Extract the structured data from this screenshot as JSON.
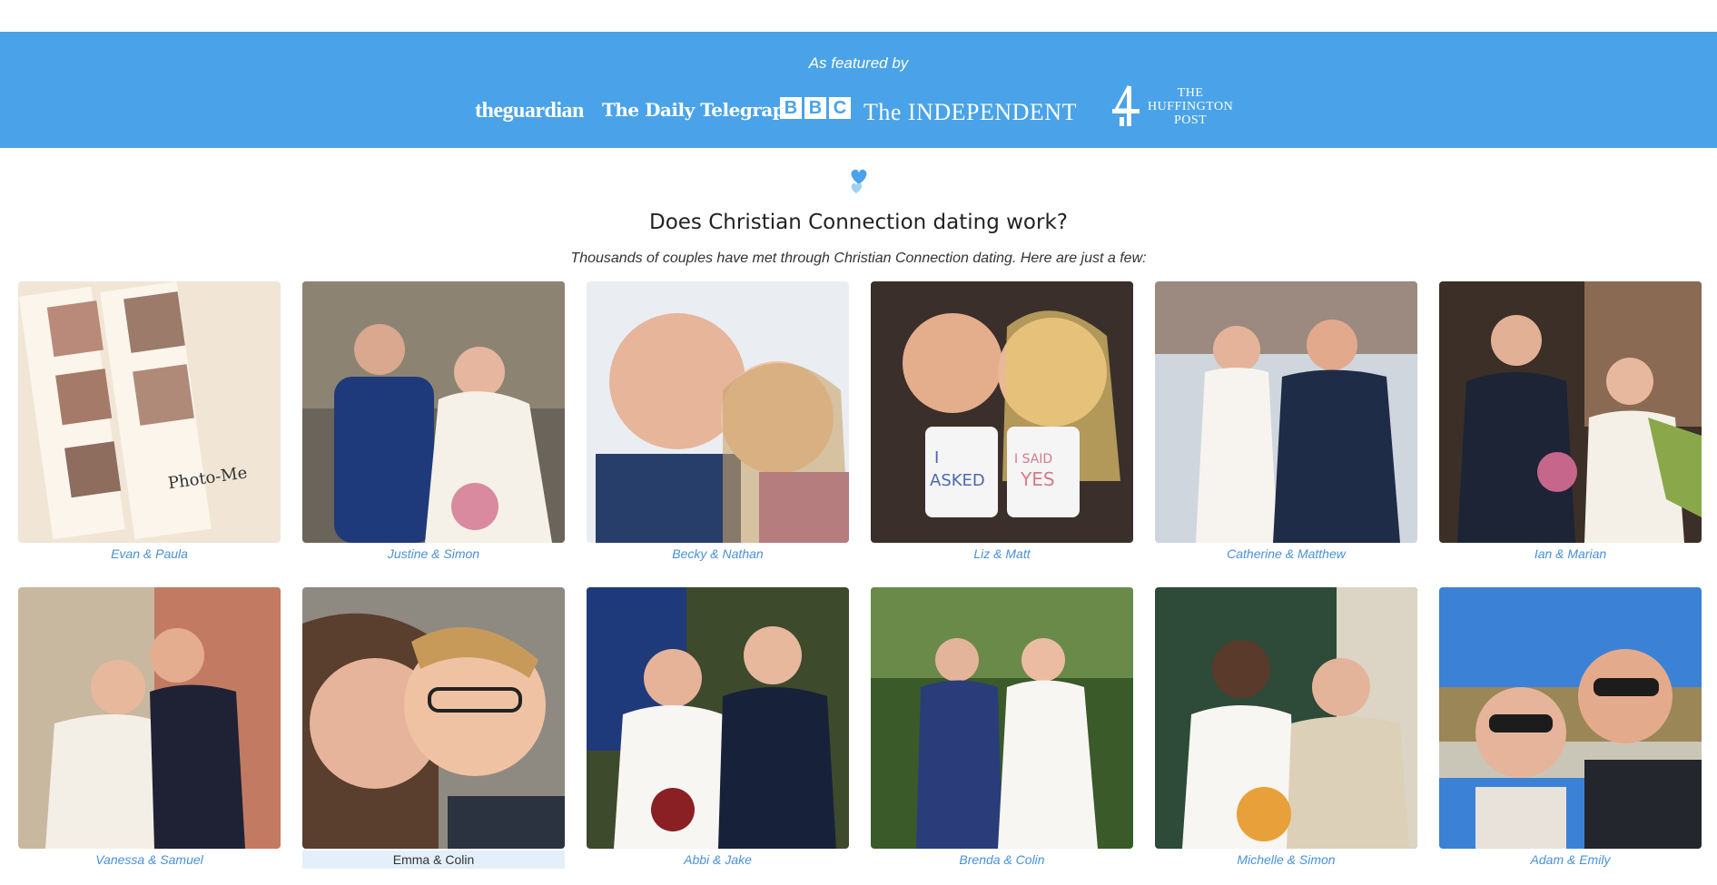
{
  "press": {
    "label": "As featured by",
    "logos": {
      "guardian": "theguardian",
      "telegraph": "The Daily Telegraph",
      "bbc": [
        "B",
        "B",
        "C"
      ],
      "independent": "The INDEPENDENT",
      "channel4": "4",
      "huffington": [
        "THE",
        "HUFFINGTON",
        "POST"
      ]
    }
  },
  "section": {
    "heading": "Does Christian Connection dating work?",
    "subheading": "Thousands of couples have met through Christian Connection dating. Here are just a few:"
  },
  "couples": [
    {
      "name": "Evan & Paula",
      "icon": "photo-booth-strip"
    },
    {
      "name": "Justine & Simon",
      "icon": "wedding-photo"
    },
    {
      "name": "Becky & Nathan",
      "icon": "selfie-photo"
    },
    {
      "name": "Liz & Matt",
      "icon": "mugs-photo"
    },
    {
      "name": "Catherine & Matthew",
      "icon": "wedding-photo"
    },
    {
      "name": "Ian & Marian",
      "icon": "wedding-photo"
    },
    {
      "name": "Vanessa & Samuel",
      "icon": "wedding-photo"
    },
    {
      "name": "Emma & Colin",
      "icon": "selfie-photo"
    },
    {
      "name": "Abbi & Jake",
      "icon": "wedding-photo"
    },
    {
      "name": "Brenda & Colin",
      "icon": "wedding-photo"
    },
    {
      "name": "Michelle & Simon",
      "icon": "wedding-photo"
    },
    {
      "name": "Adam & Emily",
      "icon": "selfie-photo"
    }
  ],
  "colors": {
    "press_band": "#4aa3e8",
    "caption": "#4a90d9",
    "caption_highlight_bg": "#e3f0fb"
  }
}
